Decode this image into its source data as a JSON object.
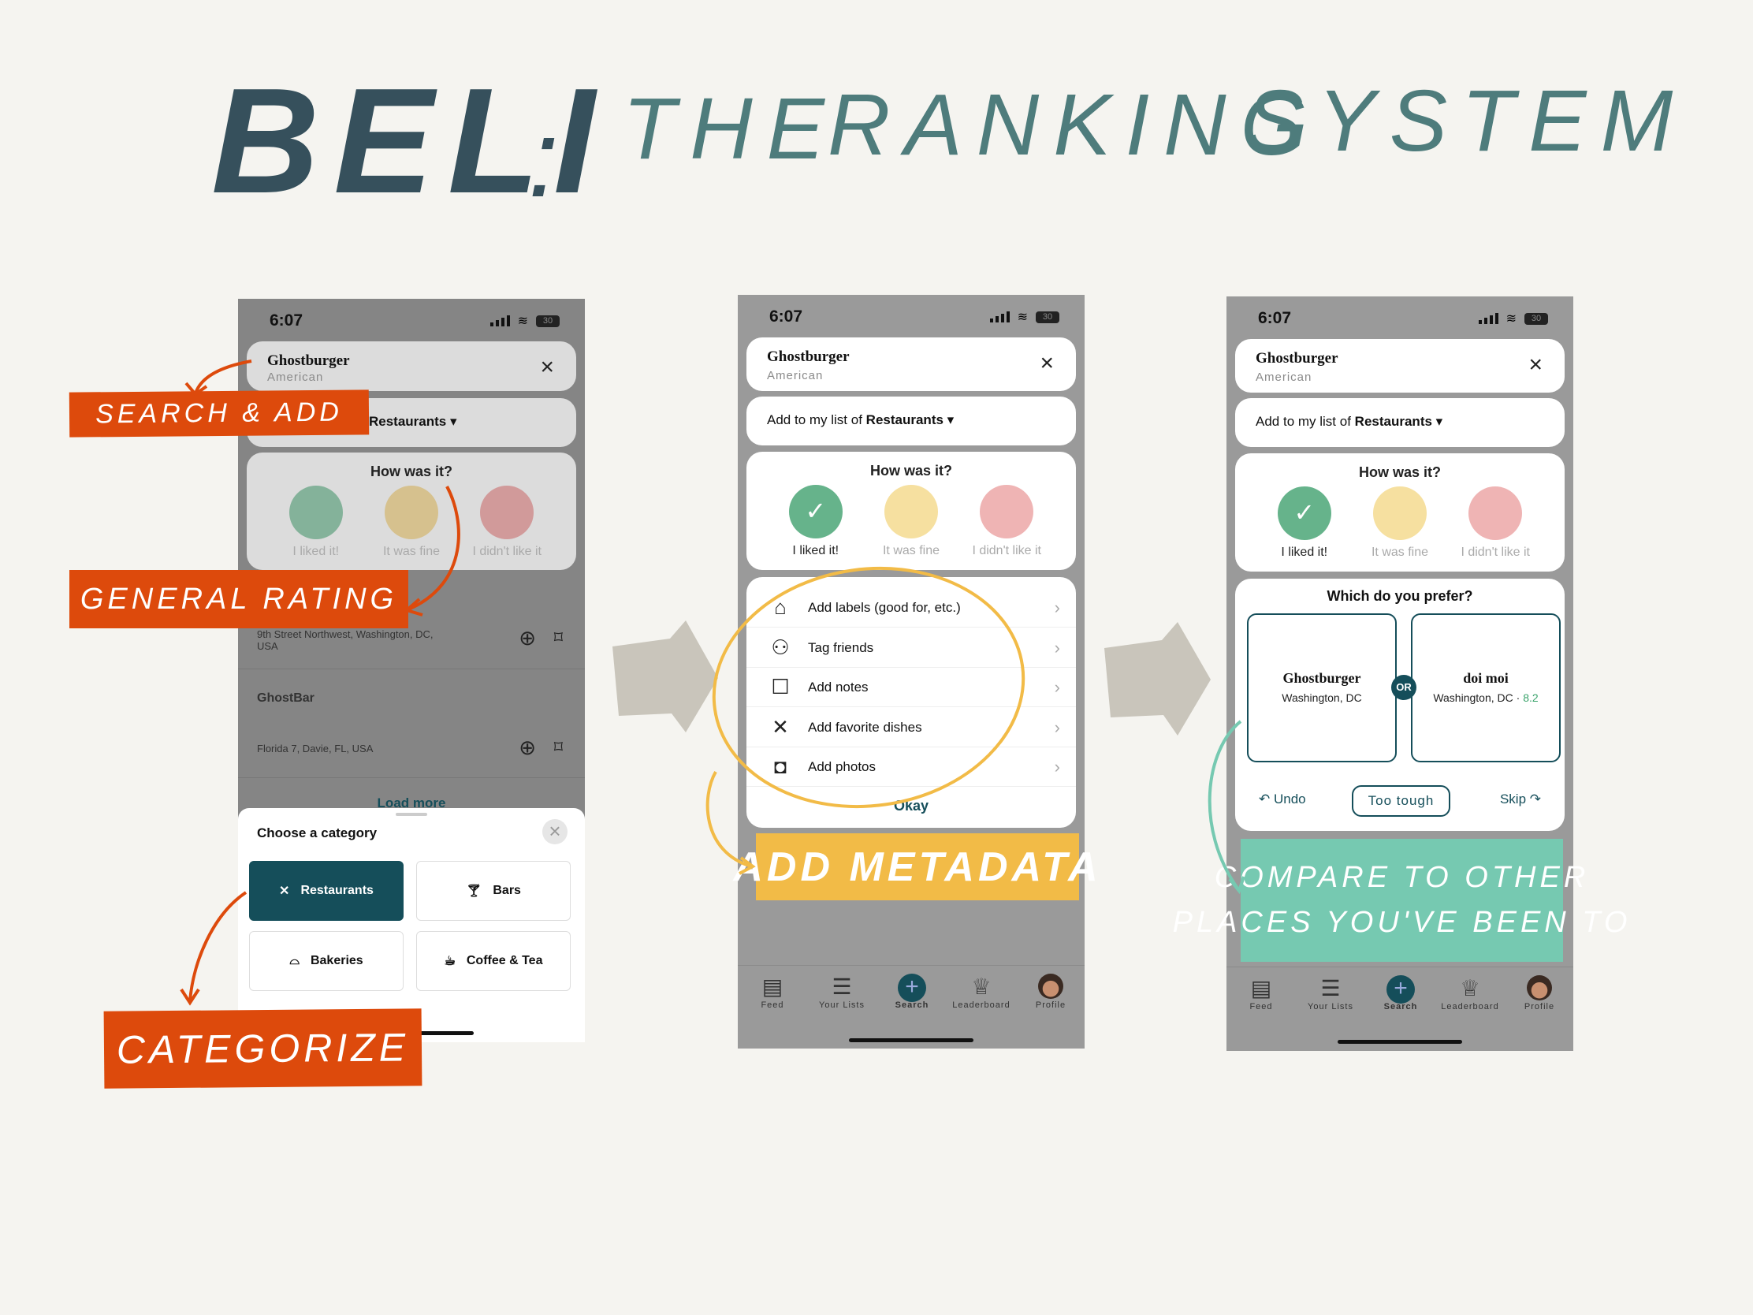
{
  "title": {
    "beli": "BELI",
    "colon": ":",
    "the": "THE",
    "ranking": "RANKING",
    "system": "SYSTEM"
  },
  "colors": {
    "orange": "#dd4a0c",
    "yellow": "#f2bb47",
    "green": "#76c9b1",
    "teal": "#154e5a",
    "liked": "#66b38b",
    "fine": "#f6e0a0",
    "disliked": "#efb4b4"
  },
  "status": {
    "time": "6:07",
    "battery": "30"
  },
  "restaurant": {
    "name": "Ghostburger",
    "cuisine": "American"
  },
  "list_prefix": "Add to my list of ",
  "list_name": "Restaurants",
  "list_short": "Restaurants",
  "rating": {
    "question": "How was it?",
    "options": [
      "I liked it!",
      "It was fine",
      "I didn't like it"
    ]
  },
  "phone1": {
    "results": [
      {
        "address": "9th Street Northwest, Washington, DC, USA"
      },
      {
        "name": "GhostBar",
        "address": "Florida 7, Davie, FL, USA"
      }
    ],
    "load_more": "Load more",
    "sheet": {
      "title": "Choose a category",
      "categories": [
        "Restaurants",
        "Bars",
        "Bakeries",
        "Coffee & Tea"
      ]
    }
  },
  "phone2": {
    "rows": [
      {
        "label": "Add labels (good for, etc.)",
        "icon": "tag-icon"
      },
      {
        "label": "Tag friends",
        "icon": "people-icon"
      },
      {
        "label": "Add notes",
        "icon": "note-icon"
      },
      {
        "label": "Add favorite dishes",
        "icon": "utensils-icon"
      },
      {
        "label": "Add photos",
        "icon": "camera-icon"
      }
    ],
    "okay": "Okay"
  },
  "phone3": {
    "question": "Which do you prefer?",
    "left": {
      "name": "Ghostburger",
      "location": "Washington, DC"
    },
    "right": {
      "name": "doi moi",
      "location": "Washington, DC · ",
      "score": "8.2"
    },
    "or": "OR",
    "undo": "Undo",
    "too_tough": "Too tough",
    "skip": "Skip"
  },
  "nav": [
    "Feed",
    "Your Lists",
    "Search",
    "Leaderboard",
    "Profile"
  ],
  "annotations": {
    "search_add": "SEARCH & ADD",
    "general_rating": "GENERAL RATING",
    "categorize": "CATEGORIZE",
    "add_metadata": "ADD METADATA",
    "compare_1": "COMPARE TO OTHER",
    "compare_2": "PLACES YOU'VE BEEN TO"
  }
}
